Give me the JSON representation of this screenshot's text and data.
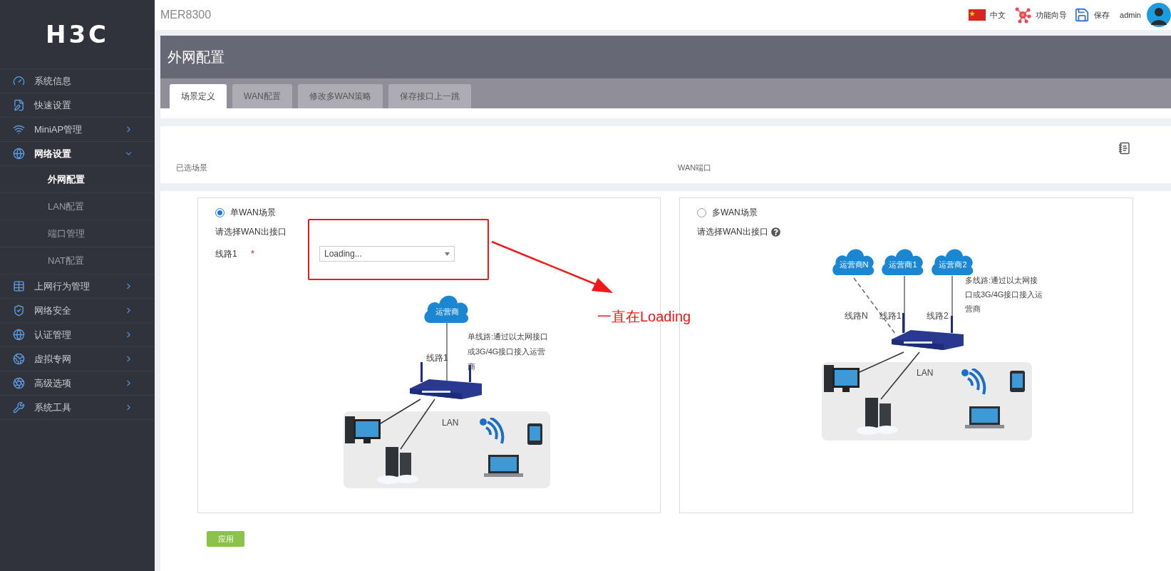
{
  "sidebar": {
    "logo": "H3C",
    "items": [
      {
        "label": "系统信息",
        "selected": false
      },
      {
        "label": "快速设置",
        "selected": false
      },
      {
        "label": "MiniAP管理",
        "selected": false,
        "expanded": false
      },
      {
        "label": "网络设置",
        "selected": false,
        "expanded": true,
        "children": [
          {
            "label": "外网配置",
            "selected": true
          },
          {
            "label": "LAN配置",
            "selected": false
          },
          {
            "label": "端口管理",
            "selected": false
          },
          {
            "label": "NAT配置",
            "selected": false
          }
        ]
      },
      {
        "label": "上网行为管理",
        "selected": false,
        "expanded": false
      },
      {
        "label": "网络安全",
        "selected": false,
        "expanded": false
      },
      {
        "label": "认证管理",
        "selected": false,
        "expanded": false
      },
      {
        "label": "虚拟专网",
        "selected": false,
        "expanded": false
      },
      {
        "label": "高级选项",
        "selected": false,
        "expanded": false
      },
      {
        "label": "系统工具",
        "selected": false,
        "expanded": false
      }
    ]
  },
  "header": {
    "product": "MER8300",
    "language": "中文",
    "wizard": "功能向导",
    "save": "保存",
    "user": "admin"
  },
  "page_title": "外网配置",
  "tabs": [
    {
      "label": "场景定义",
      "selected": true
    },
    {
      "label": "WAN配置",
      "selected": false
    },
    {
      "label": "修改多WAN策略",
      "selected": false
    },
    {
      "label": "保存接口上一跳",
      "selected": false
    }
  ],
  "summary": {
    "columns": [
      "已选场景",
      "WAN端口"
    ]
  },
  "scenarios": [
    {
      "kind": "single",
      "selected": true,
      "label": "单WAN场景",
      "prompt": "请选择WAN出接口",
      "line_label": "线路1",
      "required_mark": "*",
      "select_value": "Loading...",
      "diagram": {
        "clouds": [
          "运营商"
        ],
        "lines": [
          "线路1"
        ],
        "description": "单线路:通过以太网接口或3G/4G接口接入运营商",
        "lan": "LAN"
      }
    },
    {
      "kind": "multi",
      "selected": false,
      "label": "多WAN场景",
      "prompt": "请选择WAN出接口",
      "diagram": {
        "clouds": [
          "运营商N",
          "运营商1",
          "运营商2"
        ],
        "lines": [
          "线路N",
          "线路1",
          "线路2"
        ],
        "description": "多线路:通过以太网接口或3G/4G接口接入运营商",
        "lan": "LAN"
      }
    }
  ],
  "apply_button": "应用",
  "annotation": {
    "text": "一直在Loading"
  }
}
